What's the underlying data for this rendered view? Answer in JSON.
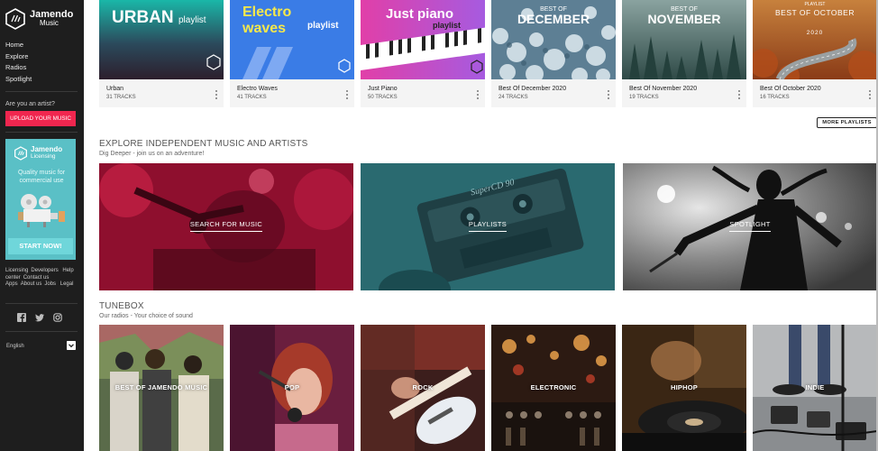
{
  "brand": {
    "name": "Jamendo",
    "sub": "Music"
  },
  "nav": [
    "Home",
    "Explore",
    "Radios",
    "Spotlight"
  ],
  "artist_prompt": "Are you an artist?",
  "upload_label": "UPLOAD YOUR MUSIC",
  "licensing": {
    "title": "Jamendo",
    "subtitle": "Licensing",
    "description": "Quality music for commercial use",
    "button": "START NOW!"
  },
  "footer_links": [
    "Licensing",
    "Developers",
    "Help center",
    "Contact us",
    "Apps",
    "About us",
    "Jobs",
    "Legal"
  ],
  "social": [
    "facebook-icon",
    "twitter-icon",
    "instagram-icon"
  ],
  "language": "English",
  "playlists": [
    {
      "name": "Urban",
      "count": "31 TRACKS",
      "art_title": "URBAN",
      "art_tag": "playlist"
    },
    {
      "name": "Electro Waves",
      "count": "41 TRACKS",
      "art_title_1": "Electro",
      "art_title_2": "waves",
      "art_tag": "playlist"
    },
    {
      "name": "Just Piano",
      "count": "50 TRACKS",
      "art_title": "Just piano",
      "art_tag": "playlist"
    },
    {
      "name": "Best Of December 2020",
      "count": "24 TRACKS",
      "art_small": "BEST OF",
      "art_title": "DECEMBER"
    },
    {
      "name": "Best Of November 2020",
      "count": "19 TRACKS",
      "art_small": "BEST OF",
      "art_title": "NOVEMBER"
    },
    {
      "name": "Best Of October 2020",
      "count": "16 TRACKS",
      "art_small": "PLAYLIST",
      "art_title": "BEST OF OCTOBER",
      "art_year": "2020"
    }
  ],
  "more_playlists": "MORE PLAYLISTS",
  "explore": {
    "title": "EXPLORE INDEPENDENT MUSIC AND ARTISTS",
    "subtitle": "Dig Deeper - join us on an adventure!",
    "tiles": [
      {
        "label": "SEARCH FOR MUSIC",
        "color": "#b3163a"
      },
      {
        "label": "PLAYLISTS",
        "color": "#2d6f74",
        "cassette_text": "SuperCD 90"
      },
      {
        "label": "SPOTLIGHT",
        "color": "#777777"
      }
    ]
  },
  "tunebox": {
    "title": "TUNEBOX",
    "subtitle": "Our radios - Your choice of sound",
    "radios": [
      "BEST OF JAMENDO MUSIC",
      "POP",
      "ROCK",
      "ELECTRONIC",
      "HIPHOP",
      "INDIE"
    ]
  },
  "colors": {
    "sidebar": "#1e1e1e",
    "accent": "#f0264f",
    "licensing": "#5ac0c6"
  }
}
